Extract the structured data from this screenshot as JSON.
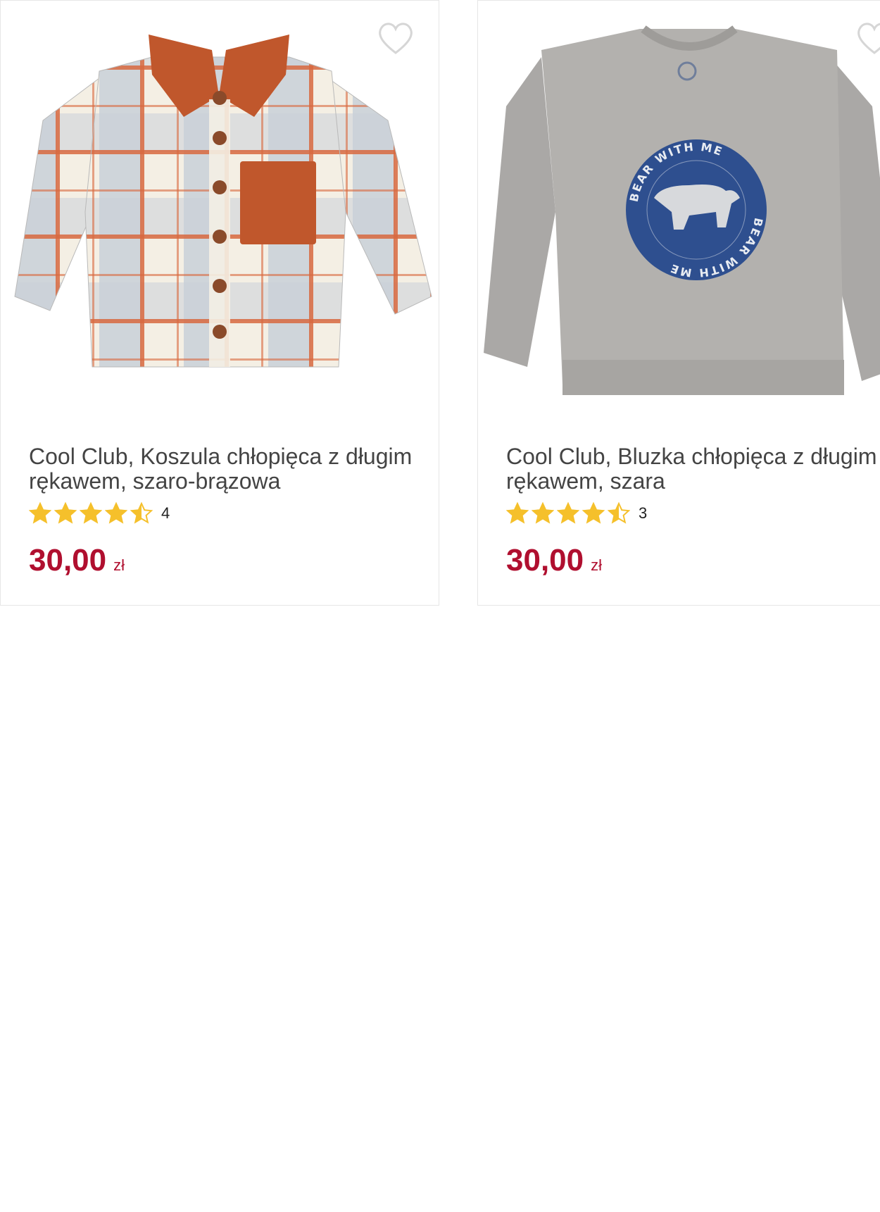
{
  "products": [
    {
      "title": "Cool Club, Koszula chłopięca z długim rękawem, szaro-brązowa",
      "rating_value": 4.5,
      "rating_count": "4",
      "price": "30,00",
      "currency": "zł",
      "image_icon": "plaid-shirt-image",
      "favorite_icon": "heart-outline-icon"
    },
    {
      "title": "Cool Club, Bluzka chłopięca z długim rękawem, szara",
      "rating_value": 4.5,
      "rating_count": "3",
      "price": "30,00",
      "currency": "zł",
      "image_icon": "grey-sweatshirt-image",
      "image_print_text": "BEAR WITH ME",
      "favorite_icon": "heart-outline-icon"
    }
  ],
  "colors": {
    "price": "#b00f2f",
    "star": "#f5c02b",
    "title": "#444444",
    "border": "#e6e6e6"
  }
}
